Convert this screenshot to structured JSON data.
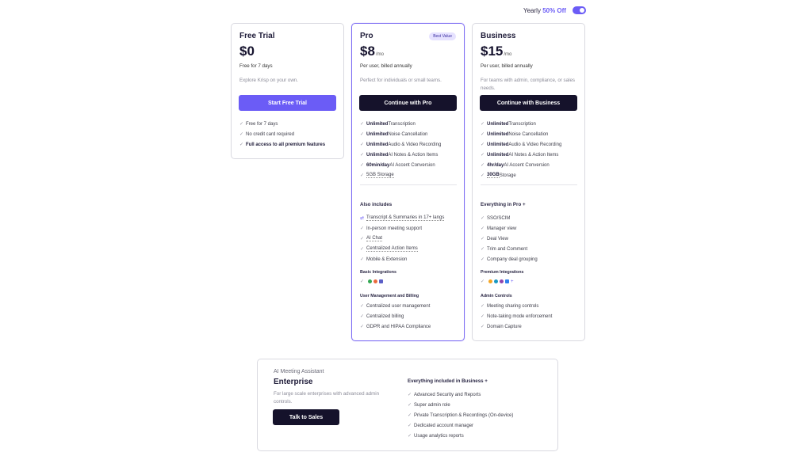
{
  "billing_toggle": {
    "label": "Yearly",
    "discount": "50% Off",
    "enabled": true
  },
  "plans": [
    {
      "name": "Free Trial",
      "price": "$0",
      "per": "",
      "billing": "Free for 7 days",
      "description": "Explore Krisp on your own.",
      "cta": "Start Free Trial",
      "features": [
        {
          "bold": "",
          "text": "Free for 7 days"
        },
        {
          "bold": "",
          "text": "No credit card required"
        },
        {
          "bold": "Full access to all premium features",
          "text": ""
        }
      ]
    },
    {
      "name": "Pro",
      "badge": "Best Value",
      "price": "$8",
      "per": "/mo",
      "billing": "Per user, billed annually",
      "description": "Perfect for individuals or small teams.",
      "cta": "Continue with Pro",
      "features": [
        {
          "bold": "Unlimited",
          "text": " Transcription"
        },
        {
          "bold": "Unlimited",
          "text": " Noise Cancellation"
        },
        {
          "bold": "Unlimited",
          "text": " Audio & Video Recording"
        },
        {
          "bold": "Unlimited",
          "text": " AI Notes & Action Items"
        },
        {
          "bold": "60min/day",
          "text": " AI Accent Conversion"
        },
        {
          "bold": "",
          "text": "5GB Storage"
        }
      ],
      "also_heading": "Also includes",
      "also": [
        "Transcript & Summaries in 17+ langs",
        "In-person meeting support",
        "AI Chat",
        "Centralized Action Items",
        "Mobile & Extension"
      ],
      "integrations_heading": "Basic Integrations",
      "integration_icons": [
        "google-meet-icon",
        "zoom-icon",
        "teams-icon"
      ],
      "management_heading": "User Management and Billing",
      "management": [
        "Centralized user management",
        "Centralized billing",
        "GDPR and HIPAA Compliance"
      ]
    },
    {
      "name": "Business",
      "price": "$15",
      "per": "/mo",
      "billing": "Per user, billed annually",
      "description": "For teams with admin, compliance, or sales needs.",
      "cta": "Continue with Business",
      "features": [
        {
          "bold": "Unlimited",
          "text": " Transcription"
        },
        {
          "bold": "Unlimited",
          "text": " Noise Cancellation"
        },
        {
          "bold": "Unlimited",
          "text": " Audio & Video Recording"
        },
        {
          "bold": "Unlimited",
          "text": " AI Notes & Action Items"
        },
        {
          "bold": "4hr/day",
          "text": " AI Accent Conversion"
        },
        {
          "bold": "30GB",
          "text": " Storage"
        }
      ],
      "also_heading": "Everything in Pro +",
      "also": [
        "SSO/SCIM",
        "Manager view",
        "Deal View",
        "Trim and Comment",
        "Company deal grouping"
      ],
      "integrations_heading": "Premium Integrations",
      "integration_icons": [
        "hubspot-icon",
        "salesforce-icon",
        "slack-icon",
        "notion-icon",
        "more-icon"
      ],
      "management_heading": "Admin Controls",
      "management": [
        "Meeting sharing controls",
        "Note-taking mode enforcement",
        "Domain Capture"
      ]
    }
  ],
  "enterprise": {
    "eyebrow": "AI Meeting Assistant",
    "name": "Enterprise",
    "description": "For large scale enterprises with advanced admin controls.",
    "cta": "Talk to Sales",
    "features_heading": "Everything included in Business +",
    "features": [
      "Advanced Security and Reports",
      "Super admin role",
      "Private Transcription & Recordings (On-device)",
      "Dedicated account manager",
      "Usage analytics reports"
    ]
  },
  "check_glyph": "✓"
}
